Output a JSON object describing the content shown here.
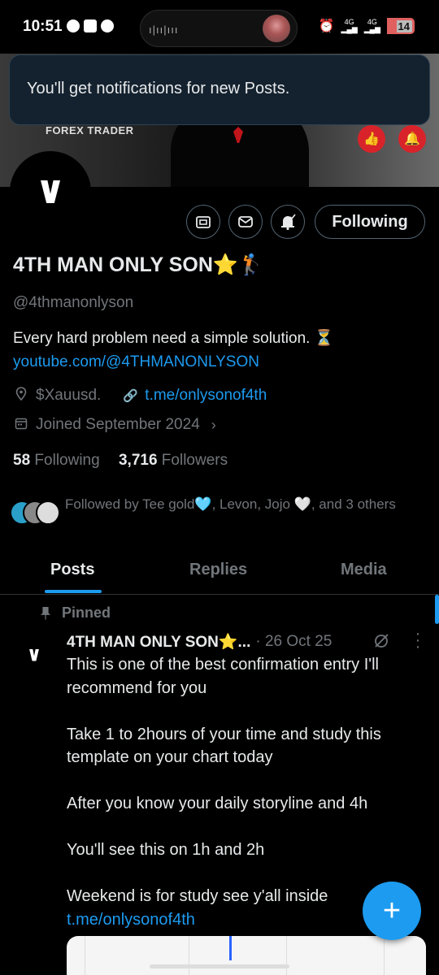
{
  "status_bar": {
    "time": "10:51",
    "network_1": "4G",
    "network_2": "4G",
    "battery": "14"
  },
  "banner": {
    "caption": "FOREX TRADER"
  },
  "toast": {
    "message": "You'll get notifications for new Posts."
  },
  "actions": {
    "follow_label": "Following"
  },
  "profile": {
    "name": "4TH MAN ONLY SON⭐🏌️",
    "handle": "@4thmanonlyson",
    "bio": "Every hard problem need a simple solution. ⏳",
    "bio_link": "youtube.com/@4THMANONLYSON",
    "location": "$Xauusd.",
    "website": "t.me/onlysonof4th",
    "joined": "Joined September 2024",
    "following_count": "58",
    "following_label": "Following",
    "followers_count": "3,716",
    "followers_label": "Followers",
    "followed_by": "Followed by Tee gold🩵, Levon, Jojo 🤍, and 3 others"
  },
  "tabs": [
    {
      "label": "Posts"
    },
    {
      "label": "Replies"
    },
    {
      "label": "Media"
    }
  ],
  "post": {
    "pinned_label": "Pinned",
    "author": "4TH MAN ONLY SON⭐...",
    "date": "· 26 Oct 25",
    "paragraphs": [
      "This is one of the best confirmation entry I'll recommend for you",
      "Take 1 to 2hours of your time and study this template on your chart today",
      "After you know your daily storyline and 4h",
      "You'll see this on 1h and 2h"
    ],
    "last_text": "Weekend is for study see y'all inside ",
    "last_link": "t.me/onlysonof4th"
  },
  "fab": {
    "label": "+"
  },
  "colors": {
    "accent": "#1d9bf0",
    "background": "#000000",
    "muted": "#71767b"
  }
}
